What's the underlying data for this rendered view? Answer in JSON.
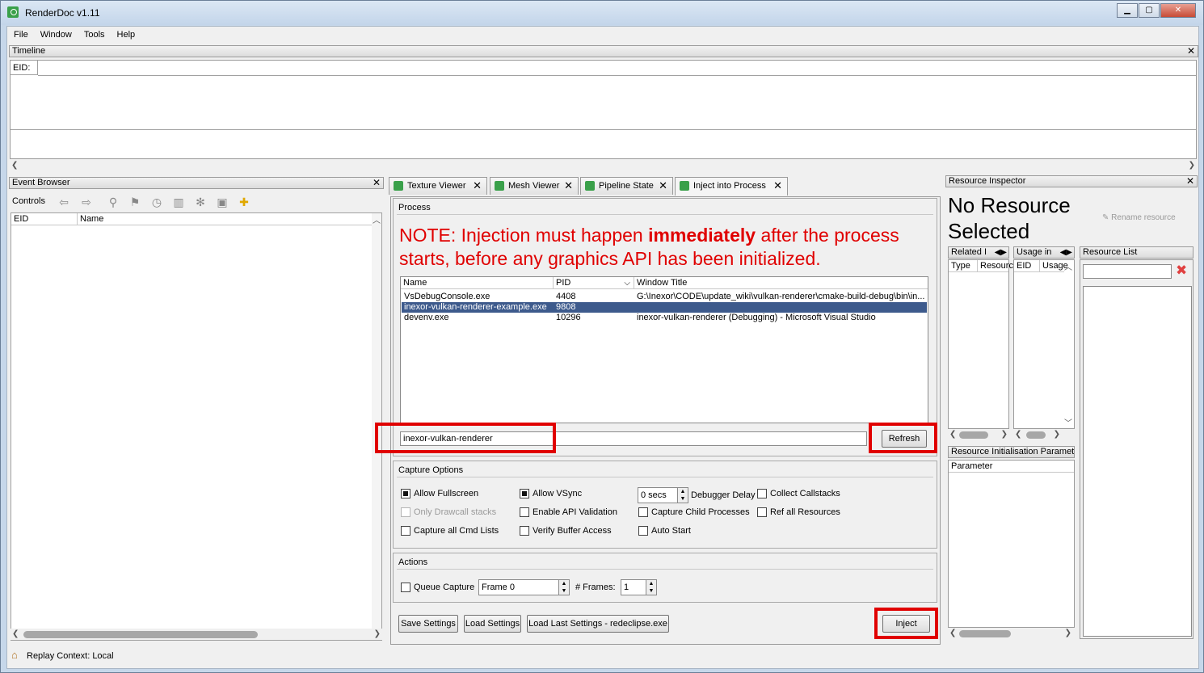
{
  "window": {
    "title": "RenderDoc v1.11",
    "min": "▁",
    "max": "▢",
    "close": "✕"
  },
  "menu": [
    "File",
    "Window",
    "Tools",
    "Help"
  ],
  "timeline": {
    "title": "Timeline",
    "eid_label": "EID:"
  },
  "event_browser": {
    "title": "Event Browser",
    "controls_label": "Controls",
    "columns": [
      "EID",
      "Name"
    ]
  },
  "tabs": [
    {
      "label": "Texture Viewer"
    },
    {
      "label": "Mesh Viewer"
    },
    {
      "label": "Pipeline State"
    },
    {
      "label": "Inject into Process"
    }
  ],
  "process": {
    "title": "Process",
    "note_pre": "NOTE: Injection must happen ",
    "note_bold": "immediately",
    "note_post": " after the process starts, before any graphics API has been initialized.",
    "columns": [
      "Name",
      "PID",
      "Window Title"
    ],
    "rows": [
      {
        "name": "VsDebugConsole.exe",
        "pid": "4408",
        "title": "G:\\Inexor\\CODE\\update_wiki\\vulkan-renderer\\cmake-build-debug\\bin\\in..."
      },
      {
        "name": "inexor-vulkan-renderer-example.exe",
        "pid": "9808",
        "title": ""
      },
      {
        "name": "devenv.exe",
        "pid": "10296",
        "title": "inexor-vulkan-renderer (Debugging) - Microsoft Visual Studio"
      }
    ],
    "filter_value": "inexor-vulkan-renderer",
    "refresh_label": "Refresh"
  },
  "capture_options": {
    "title": "Capture Options",
    "allow_fullscreen": "Allow Fullscreen",
    "allow_vsync": "Allow VSync",
    "delay_value": "0 secs",
    "debugger_delay": "Debugger Delay",
    "collect_callstacks": "Collect Callstacks",
    "only_drawcall": "Only Drawcall stacks",
    "enable_api_validation": "Enable API Validation",
    "capture_child": "Capture Child Processes",
    "ref_all": "Ref all Resources",
    "capture_cmd_lists": "Capture all Cmd Lists",
    "verify_buffer": "Verify Buffer Access",
    "auto_start": "Auto Start"
  },
  "actions": {
    "title": "Actions",
    "queue_capture": "Queue Capture",
    "frame_value": "Frame 0",
    "frames_label": "# Frames:",
    "frames_value": "1"
  },
  "bottom_buttons": {
    "save": "Save Settings",
    "load": "Load Settings",
    "load_last": "Load Last Settings - redeclipse.exe",
    "inject": "Inject"
  },
  "resource_inspector": {
    "title": "Resource Inspector",
    "no_resource": "No Resource Selected",
    "rename": "Rename resource",
    "related": "Related I",
    "usage": "Usage in",
    "related_cols": [
      "Type",
      "Resourc"
    ],
    "usage_cols": [
      "EID",
      "Usage"
    ],
    "resource_list": "Resource List",
    "init_params": "Resource Initialisation Paramete",
    "parameter": "Parameter"
  },
  "status": {
    "text": "Replay Context: Local"
  },
  "colors": {
    "note_red": "#e00000",
    "selection": "#3d5a8c",
    "highlight_box": "#e00000"
  }
}
